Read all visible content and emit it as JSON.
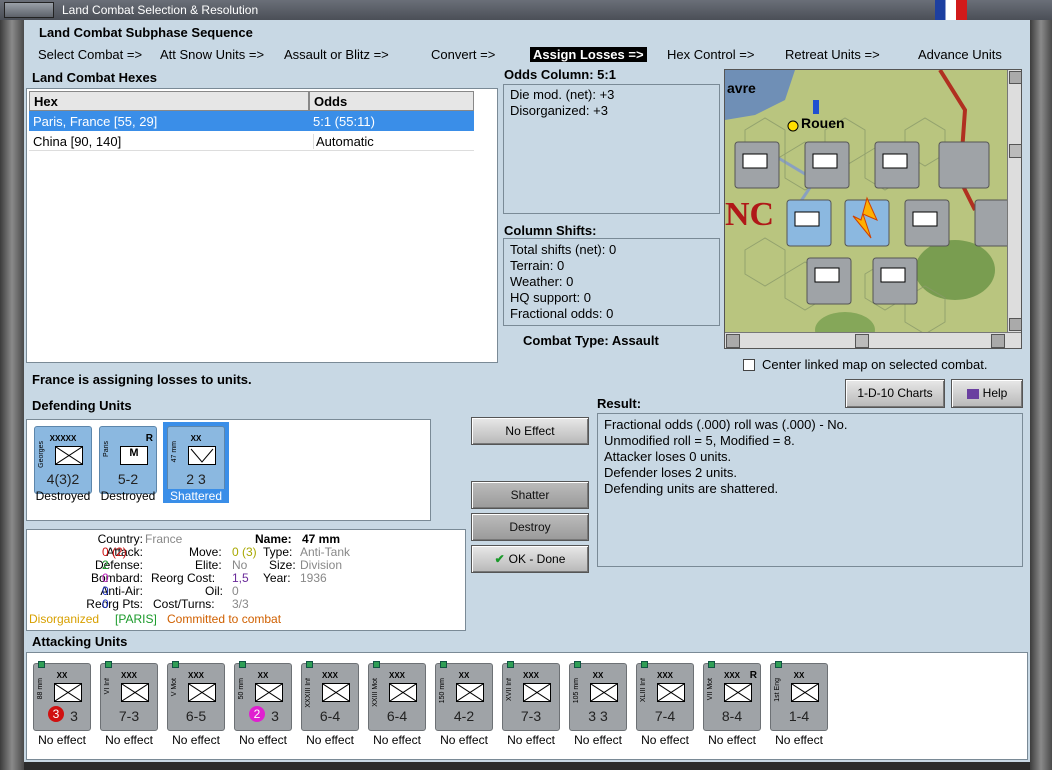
{
  "window": {
    "title": "Land Combat Selection & Resolution"
  },
  "phase": {
    "heading": "Land Combat Subphase Sequence",
    "steps": [
      "Select Combat =>",
      "Att Snow Units =>",
      "Assault or Blitz =>",
      "Convert =>",
      "Assign Losses =>",
      "Hex Control =>",
      "Retreat Units =>",
      "Advance Units"
    ]
  },
  "hexes": {
    "heading": "Land Combat Hexes",
    "columns": [
      "Hex",
      "Odds"
    ],
    "rows": [
      {
        "hex": "Paris, France [55, 29]",
        "odds": "5:1 (55:11)"
      },
      {
        "hex": "China [90, 140]",
        "odds": "Automatic"
      }
    ]
  },
  "odds": {
    "heading": "Odds Column: 5:1",
    "lines": [
      "Die mod. (net): +3",
      "Disorganized: +3"
    ]
  },
  "shifts": {
    "heading": "Column Shifts:",
    "lines": [
      "Total shifts (net): 0",
      "Terrain: 0",
      "Weather: 0",
      "HQ support: 0",
      "Fractional odds: 0"
    ]
  },
  "combat_type": "Combat Type:  Assault",
  "map": {
    "city_labels": [
      "avre",
      "Rouen"
    ],
    "center_option": "Center linked map on selected combat."
  },
  "status_msg": "France is assigning losses to units.",
  "charts_button": "1-D-10 Charts",
  "help_button": "Help",
  "defending": {
    "heading": "Defending Units",
    "units": [
      {
        "label": "Georges",
        "size": "XXXXX",
        "vals": "4(3)2",
        "status": "Destroyed"
      },
      {
        "label": "Paris",
        "size": "",
        "vals": "5-2",
        "status": "Destroyed",
        "badge": "R",
        "sym": "M"
      },
      {
        "label": "47 mm",
        "size": "XX",
        "vals": "2 3",
        "status": "Shattered"
      }
    ]
  },
  "buttons": {
    "no_effect": "No Effect",
    "shatter": "Shatter",
    "destroy": "Destroy",
    "ok": "OK - Done"
  },
  "result": {
    "heading": "Result:",
    "lines": [
      "Fractional odds (.000) roll was (.000)  - No.",
      "Unmodified roll = 5, Modified = 8.",
      "Attacker loses 0 units.",
      "Defender loses 2 units.",
      "Defending units are shattered."
    ]
  },
  "unit_info": {
    "country_l": "Country:",
    "country_v": "France",
    "attack_l": "Attack:",
    "attack_v": "0 (2)",
    "defense_l": "Defense:",
    "defense_v": "2",
    "bombard_l": "Bombard:",
    "bombard_v": "0",
    "antiair_l": "Anti-Air:",
    "antiair_v": "0",
    "reorg_l": "Reorg Pts:",
    "reorg_v": "0",
    "name_l": "Name:",
    "name_v": "47 mm",
    "move_l": "Move:",
    "move_v": "0 (3)",
    "type_l": "Type:",
    "type_v": "Anti-Tank",
    "elite_l": "Elite:",
    "elite_v": "No",
    "size_l": "Size:",
    "size_v": "Division",
    "reorgcost_l": "Reorg Cost:",
    "reorgcost_v": "1,5",
    "year_l": "Year:",
    "year_v": "1936",
    "oil_l": "Oil:",
    "oil_v": "0",
    "cost_l": "Cost/Turns:",
    "cost_v": "3/3",
    "status_a": "Disorganized",
    "status_b": "[PARIS]",
    "status_c": "Committed to combat"
  },
  "attacking": {
    "heading": "Attacking Units",
    "units": [
      {
        "label": "88 mm",
        "size": "XX",
        "vals": "3",
        "badge": "3",
        "status": "No effect"
      },
      {
        "label": "VI Inf",
        "size": "XXX",
        "vals": "7-3",
        "status": "No effect"
      },
      {
        "label": "V Mot",
        "size": "XXX",
        "vals": "6-5",
        "status": "No effect"
      },
      {
        "label": "50 mm",
        "size": "XX",
        "vals": "3",
        "badge": "2",
        "status": "No effect"
      },
      {
        "label": "XXXIII Inf",
        "size": "XXX",
        "vals": "6-4",
        "status": "No effect"
      },
      {
        "label": "XXIII Mot",
        "size": "XXX",
        "vals": "6-4",
        "status": "No effect"
      },
      {
        "label": "150 mm",
        "size": "XX",
        "vals": "4-2",
        "status": "No effect"
      },
      {
        "label": "XVII Inf",
        "size": "XXX",
        "vals": "7-3",
        "status": "No effect"
      },
      {
        "label": "105 mm",
        "size": "XX",
        "vals": "3 3",
        "status": "No effect"
      },
      {
        "label": "XLIII Inf",
        "size": "XXX",
        "vals": "7-4",
        "status": "No effect"
      },
      {
        "label": "VII Mot",
        "size": "XXX",
        "vals": "8-4",
        "status": "No effect",
        "badge_r": "R"
      },
      {
        "label": "1st Eng",
        "size": "XX",
        "vals": "1-4",
        "status": "No effect"
      }
    ]
  },
  "colors": {
    "selection": "#3a8ee8",
    "panel_bg": "#c8d8e4",
    "red": "#d01010",
    "magenta": "#e020d0"
  }
}
